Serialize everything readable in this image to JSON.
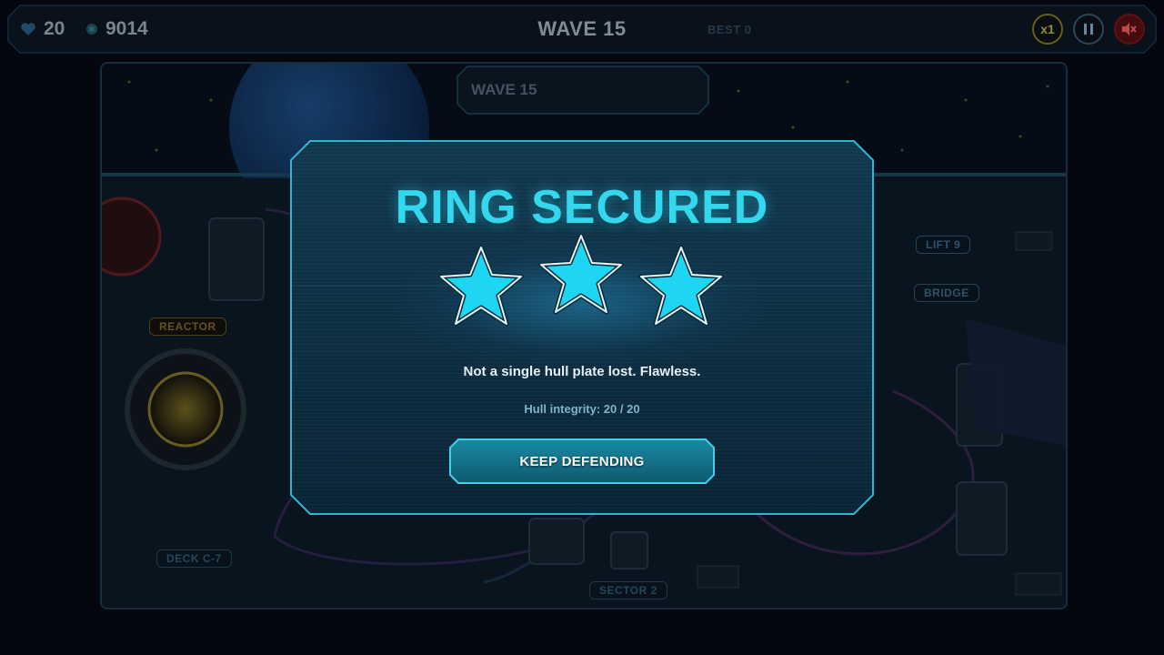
{
  "hud": {
    "lives": "20",
    "coins": "9014",
    "wave_title": "WAVE 15",
    "best": "BEST 0",
    "speed_label": "x1",
    "pause_icon": "pause-icon",
    "mute_icon": "mute-icon",
    "lives_icon": "heart-icon",
    "coins_icon": "coin-icon"
  },
  "map": {
    "wave_banner": "WAVE 15",
    "labels": {
      "reactor": "REACTOR",
      "deck": "DECK C-7",
      "sector": "SECTOR 2",
      "lift": "LIFT 9",
      "bridge": "BRIDGE"
    }
  },
  "modal": {
    "title": "RING SECURED",
    "stars_earned": 3,
    "stars_total": 3,
    "message": "Not a single hull plate lost. Flawless.",
    "integrity": "Hull integrity: 20 / 20",
    "button_label": "KEEP DEFENDING"
  },
  "colors": {
    "accent": "#33d8ee",
    "star": "#1fd6f2",
    "panel": "#0d2c3f",
    "button": "#126b80"
  }
}
